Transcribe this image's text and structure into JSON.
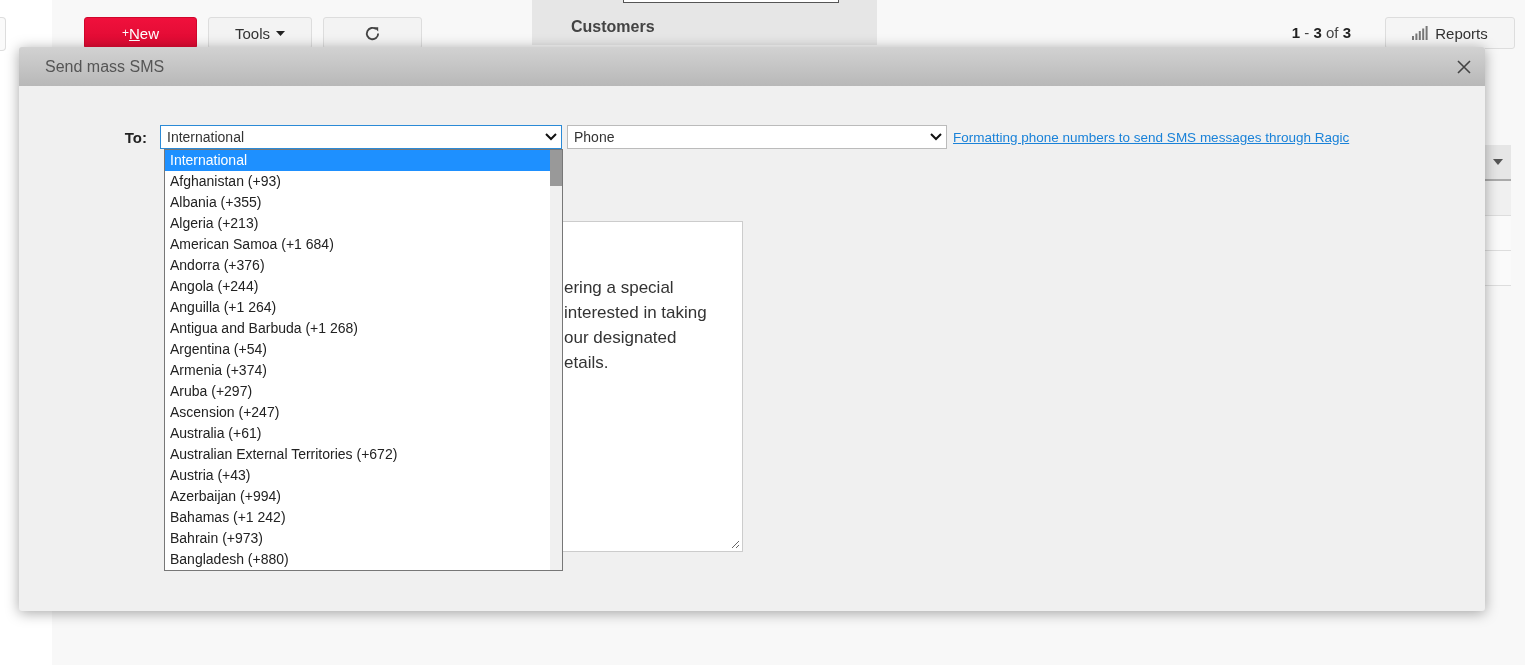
{
  "toolbar": {
    "new_button": {
      "plus": "+",
      "label": "New"
    },
    "tools_button": "Tools",
    "page_tab": "Customers",
    "pager": "**1** - **3** of **3**",
    "reports_button": "Reports"
  },
  "dialog": {
    "title": "Send mass SMS",
    "to_label": "To:",
    "country_select": {
      "value": "International",
      "expanded": true
    },
    "field_select": {
      "value": "Phone"
    },
    "help_link": "Formatting phone numbers to send SMS messages through Ragic",
    "country_options": [
      {
        "label": "International",
        "selected": true
      },
      {
        "label": "Afghanistan (+93)",
        "selected": false
      },
      {
        "label": "Albania (+355)",
        "selected": false
      },
      {
        "label": "Algeria (+213)",
        "selected": false
      },
      {
        "label": "American Samoa (+1 684)",
        "selected": false
      },
      {
        "label": "Andorra (+376)",
        "selected": false
      },
      {
        "label": "Angola (+244)",
        "selected": false
      },
      {
        "label": "Anguilla (+1 264)",
        "selected": false
      },
      {
        "label": "Antigua and Barbuda (+1 268)",
        "selected": false
      },
      {
        "label": "Argentina (+54)",
        "selected": false
      },
      {
        "label": "Armenia (+374)",
        "selected": false
      },
      {
        "label": "Aruba (+297)",
        "selected": false
      },
      {
        "label": "Ascension (+247)",
        "selected": false
      },
      {
        "label": "Australia (+61)",
        "selected": false
      },
      {
        "label": "Australian External Territories (+672)",
        "selected": false
      },
      {
        "label": "Austria (+43)",
        "selected": false
      },
      {
        "label": "Azerbaijan (+994)",
        "selected": false
      },
      {
        "label": "Bahamas (+1 242)",
        "selected": false
      },
      {
        "label": "Bahrain (+973)",
        "selected": false
      },
      {
        "label": "Bangladesh (+880)",
        "selected": false
      }
    ],
    "message_lines": [
      "ering a special",
      "interested in taking",
      "our designated",
      "etails."
    ]
  }
}
